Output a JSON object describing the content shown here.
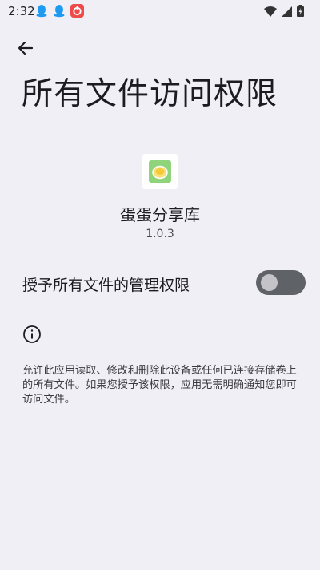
{
  "status_bar": {
    "time": "2:32",
    "notification_icons": [
      "qq-icon",
      "qq-icon",
      "app-notification-icon"
    ],
    "system_icons": [
      "wifi-icon",
      "cellular-signal-icon",
      "battery-icon"
    ]
  },
  "header": {
    "back_icon": "arrow-back-icon",
    "title": "所有文件访问权限"
  },
  "app": {
    "icon": "app-icon",
    "name": "蛋蛋分享库",
    "version": "1.0.3"
  },
  "permission": {
    "label": "授予所有文件的管理权限",
    "enabled": false
  },
  "info": {
    "icon": "info-icon",
    "description": "允许此应用读取、修改和删除此设备或任何已连接存储卷上的所有文件。如果您授予该权限，应用无需明确通知您即可访问文件。"
  },
  "colors": {
    "background": "#f1eff6",
    "toggle_track": "#5f6368",
    "toggle_thumb": "#c4c4c8"
  }
}
